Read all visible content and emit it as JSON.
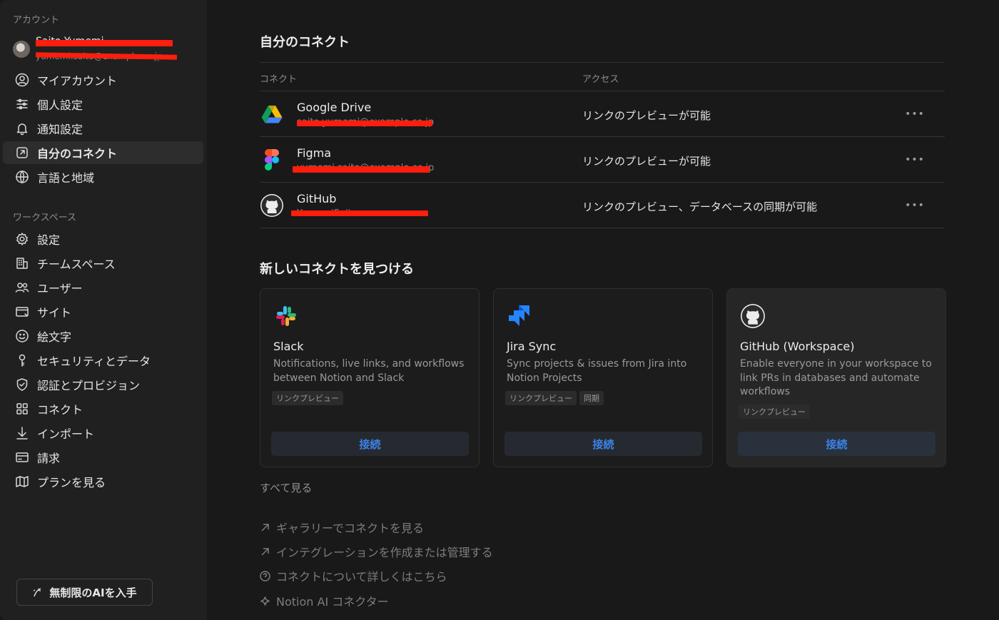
{
  "sidebar": {
    "account_label": "アカウント",
    "user": {
      "name": "Saito Yumemi",
      "email": "yumemi.saito@example.co.jp"
    },
    "account_items": [
      {
        "label": "マイアカウント",
        "icon": "user-circle-icon"
      },
      {
        "label": "個人設定",
        "icon": "sliders-icon"
      },
      {
        "label": "通知設定",
        "icon": "bell-icon"
      },
      {
        "label": "自分のコネクト",
        "icon": "arrow-box-icon",
        "active": true
      },
      {
        "label": "言語と地域",
        "icon": "globe-icon"
      }
    ],
    "workspace_label": "ワークスペース",
    "workspace_items": [
      {
        "label": "設定",
        "icon": "gear-icon"
      },
      {
        "label": "チームスペース",
        "icon": "building-icon"
      },
      {
        "label": "ユーザー",
        "icon": "users-icon"
      },
      {
        "label": "サイト",
        "icon": "browser-icon"
      },
      {
        "label": "絵文字",
        "icon": "smiley-icon"
      },
      {
        "label": "セキュリティとデータ",
        "icon": "key-icon"
      },
      {
        "label": "認証とプロビジョン",
        "icon": "shield-check-icon"
      },
      {
        "label": "コネクト",
        "icon": "grid-icon"
      },
      {
        "label": "インポート",
        "icon": "download-arrow-icon"
      },
      {
        "label": "請求",
        "icon": "card-icon"
      },
      {
        "label": "プランを見る",
        "icon": "map-icon"
      }
    ],
    "ai_button": "無制限のAIを入手"
  },
  "main": {
    "my_connections_title": "自分のコネクト",
    "columns": {
      "connection": "コネクト",
      "access": "アクセス"
    },
    "connections": [
      {
        "name": "Google Drive",
        "sub": "saito.yumemi@example.co.jp",
        "access": "リンクのプレビューが可能",
        "icon": "google-drive-icon"
      },
      {
        "name": "Figma",
        "sub": "yumemi.saito@example.co.jp",
        "access": "リンクのプレビューが可能",
        "icon": "figma-icon"
      },
      {
        "name": "GitHub",
        "sub": "YumemiSaito",
        "access": "リンクのプレビュー、データベースの同期が可能",
        "icon": "github-icon"
      }
    ],
    "more_label": "•••",
    "discover_title": "新しいコネクトを見つける",
    "cards": [
      {
        "title": "Slack",
        "desc": "Notifications, live links, and workflows between Notion and Slack",
        "tags": [
          "リンクプレビュー"
        ],
        "button": "接続",
        "icon": "slack-icon"
      },
      {
        "title": "Jira Sync",
        "desc": "Sync projects & issues from Jira into Notion Projects",
        "tags": [
          "リンクプレビュー",
          "同期"
        ],
        "button": "接続",
        "icon": "jira-icon"
      },
      {
        "title": "GitHub (Workspace)",
        "desc": "Enable everyone in your workspace to link PRs in databases and automate workflows",
        "tags": [
          "リンクプレビュー"
        ],
        "button": "接続",
        "icon": "github-icon"
      }
    ],
    "see_all": "すべて見る",
    "links": [
      {
        "label": "ギャラリーでコネクトを見る",
        "icon": "arrow-up-right-icon"
      },
      {
        "label": "インテグレーションを作成または管理する",
        "icon": "arrow-up-right-icon"
      },
      {
        "label": "コネクトについて詳しくはこちら",
        "icon": "question-circle-icon"
      },
      {
        "label": "Notion AI コネクター",
        "icon": "sparkle-icon"
      }
    ],
    "accent_color": "#3b82e6",
    "redaction_color": "#ff1d0d"
  }
}
